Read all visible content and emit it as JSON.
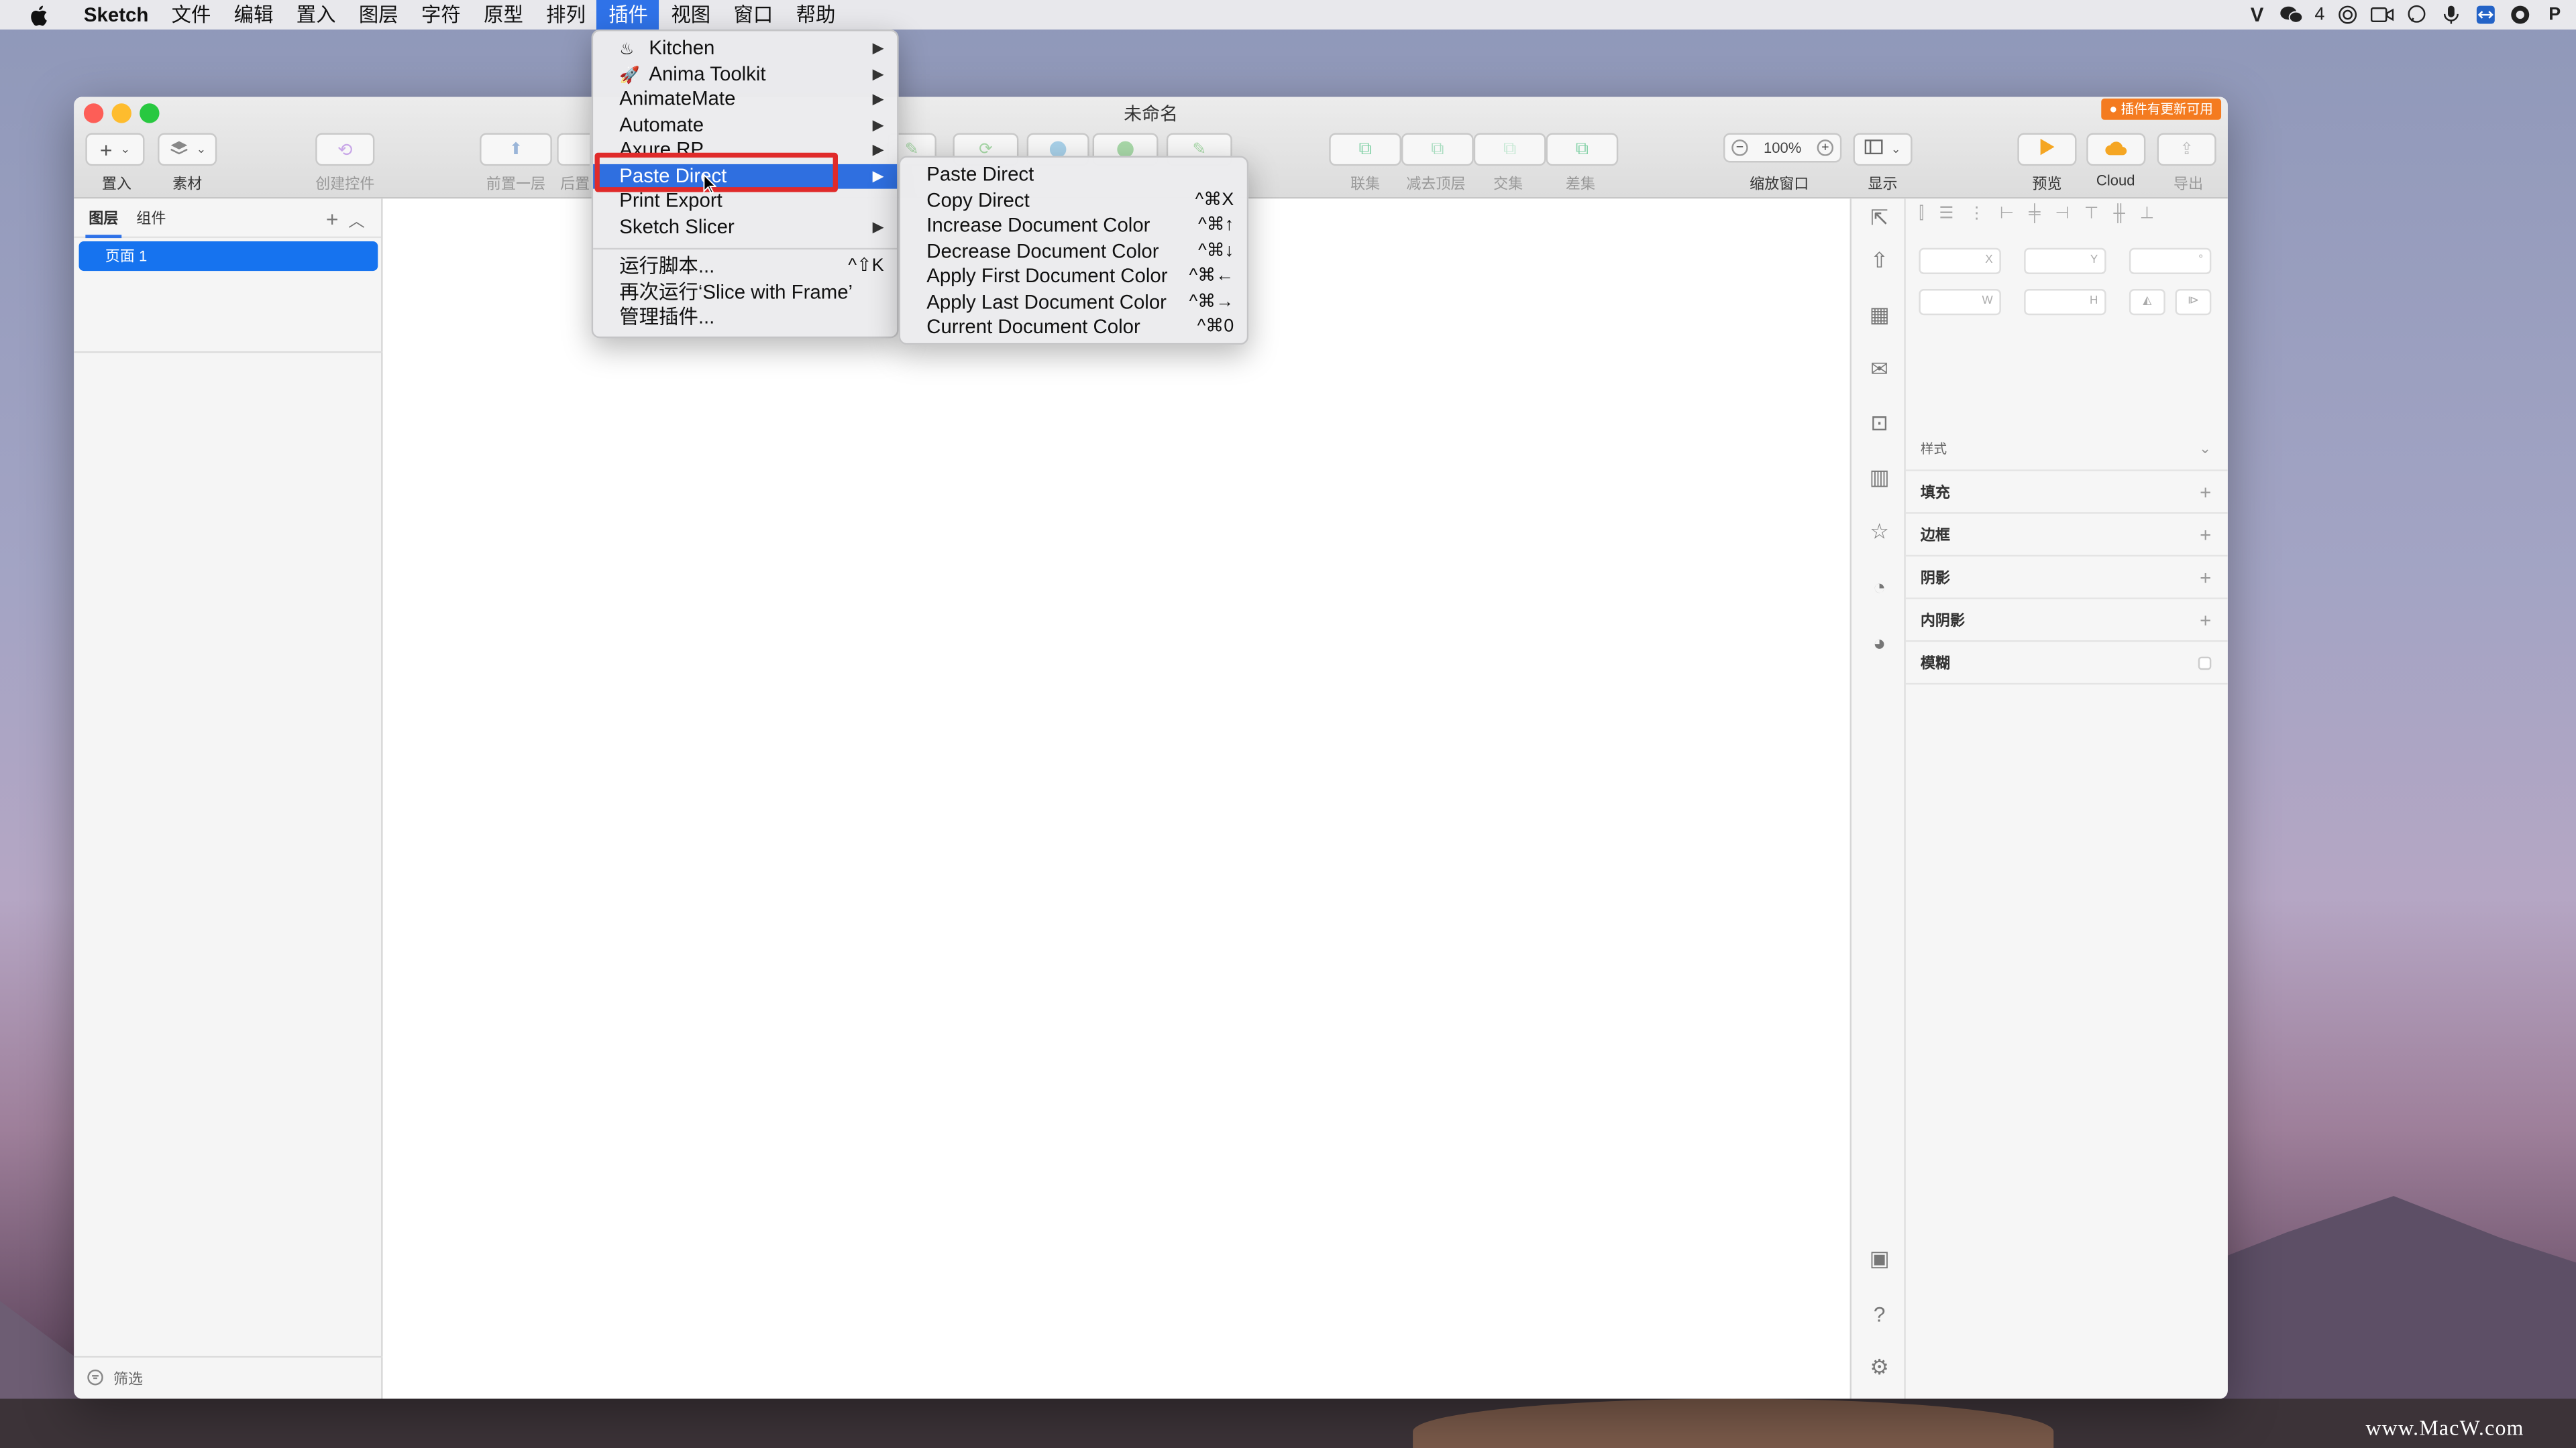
{
  "menubar": {
    "app": "Sketch",
    "items": [
      "文件",
      "编辑",
      "置入",
      "图层",
      "字符",
      "原型",
      "排列",
      "插件",
      "视图",
      "窗口",
      "帮助"
    ],
    "active_item": "插件",
    "wechat_count": "4"
  },
  "window": {
    "title": "未命名",
    "update_badge": "● 插件有更新可用"
  },
  "toolbar": {
    "insert_label": "置入",
    "assets_label": "素材",
    "create_symbol_label": "创建控件",
    "forward_label": "前置一层",
    "backward_label": "后置",
    "union_label": "联集",
    "subtract_label": "减去顶层",
    "intersect_label": "交集",
    "difference_label": "差集",
    "zoom_value": "100%",
    "zoom_label": "缩放窗口",
    "view_label": "显示",
    "preview_label": "预览",
    "cloud_label": "Cloud",
    "export_label": "导出"
  },
  "left_panel": {
    "tab_layers": "图层",
    "tab_components": "组件",
    "page_item": "页面 1",
    "filter_label": "筛选"
  },
  "inspector": {
    "x_label": "X",
    "y_label": "Y",
    "angle_label": "°",
    "w_label": "W",
    "h_label": "H",
    "style_label": "样式",
    "fill_label": "填充",
    "border_label": "边框",
    "shadow_label": "阴影",
    "inner_shadow_label": "内阴影",
    "blur_label": "模糊"
  },
  "plugins_menu": {
    "items": [
      {
        "label": "Kitchen",
        "icon": "chef-icon",
        "submenu": true
      },
      {
        "label": "Anima Toolkit",
        "icon": "rocket-icon",
        "submenu": true
      },
      {
        "label": "AnimateMate",
        "submenu": true
      },
      {
        "label": "Automate",
        "submenu": true
      },
      {
        "label": "Axure RP",
        "submenu": true
      },
      {
        "label": "Paste Direct",
        "submenu": true,
        "selected": true
      },
      {
        "label": "Print Export",
        "submenu": false
      },
      {
        "label": "Sketch Slicer",
        "submenu": true
      }
    ],
    "run_script": "运行脚本...",
    "run_script_shortcut": "^⇧K",
    "rerun": "再次运行‘Slice with Frame’",
    "manage": "管理插件..."
  },
  "paste_direct_submenu": {
    "items": [
      {
        "label": "Paste Direct",
        "shortcut": ""
      },
      {
        "label": "Copy Direct",
        "shortcut": "^⌘X"
      },
      {
        "label": "Increase Document Color",
        "shortcut": "^⌘↑"
      },
      {
        "label": "Decrease Document Color",
        "shortcut": "^⌘↓"
      },
      {
        "label": "Apply First Document Color",
        "shortcut": "^⌘←"
      },
      {
        "label": "Apply Last Document Color",
        "shortcut": "^⌘→"
      },
      {
        "label": "Current Document Color",
        "shortcut": "^⌘0"
      }
    ]
  },
  "watermark": "www.MacW.com",
  "colors": {
    "accent": "#2f72e8",
    "highlight_box": "#e02a2a",
    "badge": "#f47b20",
    "page_selected": "#1673ef"
  }
}
